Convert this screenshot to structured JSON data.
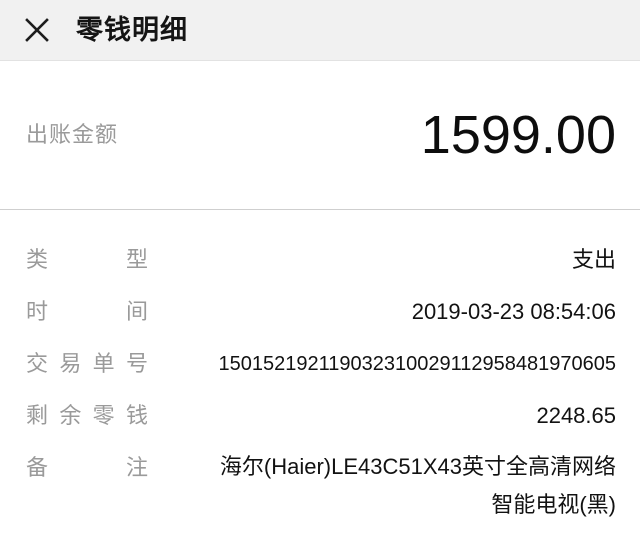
{
  "header": {
    "close_icon": "close-icon",
    "title": "零钱明细"
  },
  "amount": {
    "label": "出账金额",
    "value": "1599.00"
  },
  "details": {
    "rows": [
      {
        "label": "类型",
        "value": "支出",
        "name": "type"
      },
      {
        "label": "时间",
        "value": "2019-03-23 08:54:06",
        "name": "time"
      },
      {
        "label": "交易单号",
        "value": "150152192119032310029112958481970605",
        "name": "transaction-id"
      },
      {
        "label": "剩余零钱",
        "value": "2248.65",
        "name": "balance"
      },
      {
        "label": "备注",
        "value": "海尔(Haier)LE43C51X43英寸全高清网络智能电视(黑)",
        "name": "remark"
      }
    ]
  },
  "colors": {
    "header_background": "#f1f1f1",
    "page_background": "#ffffff",
    "label_gray": "#9a9a9a",
    "value_black": "#121212",
    "divider": "#cfcfcf"
  }
}
